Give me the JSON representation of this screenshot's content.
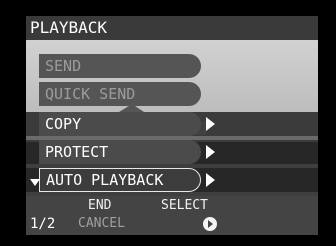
{
  "menu": {
    "title": "PLAYBACK",
    "items": [
      {
        "label": "SEND",
        "state": "disabled"
      },
      {
        "label": "QUICK SEND",
        "state": "disabled"
      },
      {
        "label": "COPY",
        "state": "enabled"
      },
      {
        "label": "PROTECT",
        "state": "enabled"
      },
      {
        "label": "AUTO PLAYBACK",
        "state": "selected"
      }
    ]
  },
  "footer": {
    "end_label": "END",
    "cancel_label": "CANCEL",
    "select_label": "SELECT",
    "page": "1/2"
  },
  "icons": {
    "submenu": "right-triangle-icon",
    "scroll": "down-triangle-icon",
    "select": "ok-button-icon"
  }
}
